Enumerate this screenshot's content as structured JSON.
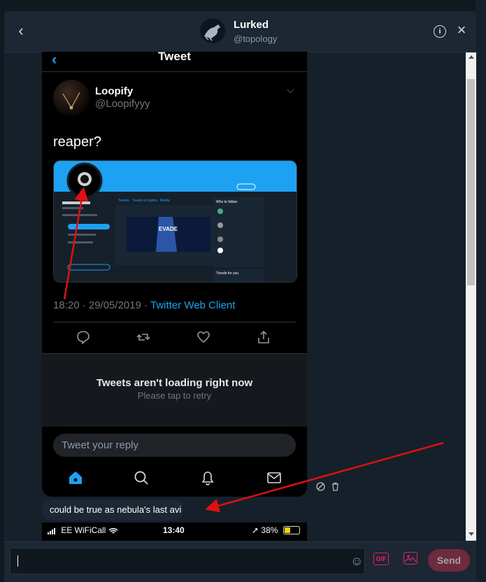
{
  "header": {
    "title": "Lurked",
    "handle": "@topology"
  },
  "screenshot": {
    "tweet_header": "Tweet",
    "author_name": "Loopify",
    "author_handle": "@Loopifyyy",
    "tweet_text": "reaper?",
    "timestamp": "18:20 · 29/05/2019 · ",
    "client": "Twitter Web Client",
    "error_title": "Tweets aren't loading right now",
    "error_subtitle": "Please tap to retry",
    "reply_placeholder": "Tweet your reply",
    "embedded_profile": {
      "tabs": [
        "Tweets",
        "Tweets & replies",
        "Media"
      ],
      "who_to_follow": "Who to follow",
      "trends": "Trends for you",
      "banner_text": "EVADE"
    }
  },
  "message": {
    "text": "could be true as nebula's last avi"
  },
  "second_screenshot": {
    "carrier": "EE WiFiCall",
    "time": "13:40",
    "battery": "38%",
    "battery_level": 0.38
  },
  "composer": {
    "input_value": "",
    "gif_label": "GIF",
    "send_label": "Send"
  },
  "colors": {
    "accent": "#1da1f2",
    "annotation": "#e01010",
    "send_disabled": "#6e2a3f"
  }
}
